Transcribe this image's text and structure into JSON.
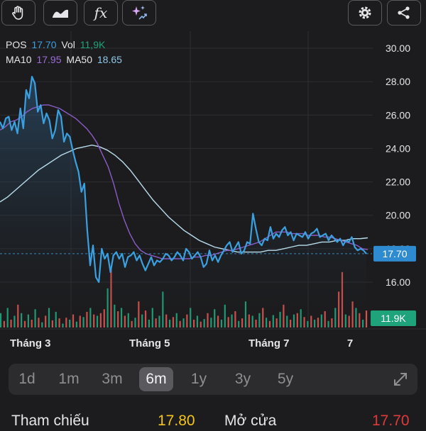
{
  "toolbar": {
    "icons": [
      "hand-icon",
      "area-chart-icon",
      "function-icon",
      "ai-sparkle-icon",
      "gear-icon",
      "share-icon"
    ],
    "function_label": "fx"
  },
  "info": {
    "ticker": "POS",
    "price": "17.70",
    "vol_label": "Vol",
    "vol": "11,9K",
    "ma10_label": "MA10",
    "ma10": "17.95",
    "ma50_label": "MA50",
    "ma50": "18.65"
  },
  "colors": {
    "price_line": "#3aa0e0",
    "ma10": "#8b5cc7",
    "ma50": "#b8dcec",
    "vol_up": "#1fa37a",
    "vol_down": "#d9534f",
    "price_tag": "#2e8bcf",
    "vol_tag": "#1fa37a",
    "ref": "#f5c518",
    "open": "#e03a3a"
  },
  "chart_data": {
    "type": "line",
    "ylim": [
      15.0,
      30.4
    ],
    "y_ticks": [
      "30.00",
      "28.00",
      "26.00",
      "24.00",
      "22.00",
      "20.00",
      "18.00",
      "16.00"
    ],
    "x_ticks": [
      "Tháng 3",
      "Tháng 5",
      "Tháng 7",
      "7"
    ],
    "current_price_tag": "17.70",
    "current_volume_tag": "11.9K",
    "series": [
      {
        "name": "POS",
        "values": [
          25.6,
          25.2,
          25.8,
          25.9,
          25.1,
          25.6,
          24.9,
          26.4,
          25.2,
          27.5,
          27.0,
          28.3,
          27.9,
          26.2,
          26.6,
          25.5,
          26.1,
          25.7,
          24.6,
          25.1,
          26.3,
          25.9,
          24.4,
          24.9,
          24.7,
          23.9,
          23.2,
          22.6,
          21.4,
          21.9,
          19.1,
          17.0,
          18.2,
          16.3,
          16.0,
          18.0,
          17.4,
          17.7,
          16.6,
          17.6,
          17.8,
          17.4,
          17.7,
          16.9,
          17.5,
          17.6,
          17.8,
          17.3,
          17.6,
          17.1,
          16.7,
          17.1,
          17.5,
          17.0,
          17.3,
          17.2,
          17.4,
          17.7,
          17.6,
          17.3,
          17.5,
          17.8,
          17.6,
          17.3,
          18.0,
          17.8,
          17.4,
          17.6,
          17.8,
          17.5,
          16.9,
          17.1,
          17.9,
          17.3,
          17.6,
          17.2,
          17.6,
          17.9,
          18.2,
          18.4,
          17.8,
          18.1,
          18.4,
          17.7,
          17.9,
          18.4,
          18.3,
          20.1,
          19.2,
          18.4,
          18.2,
          18.6,
          18.5,
          19.3,
          18.6,
          18.9,
          18.7,
          19.1,
          19.3,
          18.8,
          19.0,
          18.5,
          18.9,
          18.8,
          18.7,
          19.0,
          18.6,
          18.9,
          19.0,
          19.2,
          18.7,
          18.8,
          18.9,
          18.5,
          18.8,
          18.6,
          18.4,
          18.6,
          18.2,
          18.5,
          18.4,
          18.7,
          18.1,
          17.9,
          18.0,
          17.9,
          17.7
        ]
      },
      {
        "name": "MA10",
        "values": [
          25.1,
          25.3,
          25.6,
          25.7,
          25.9,
          26.2,
          26.4,
          26.5,
          26.6,
          26.6,
          26.5,
          26.4,
          26.2,
          26.0,
          25.8,
          25.5,
          25.2,
          24.8,
          24.3,
          23.6,
          22.9,
          21.9,
          20.7,
          19.7,
          18.9,
          18.3,
          17.9,
          17.7,
          17.6,
          17.5,
          17.4,
          17.4,
          17.4,
          17.4,
          17.4,
          17.4,
          17.5,
          17.5,
          17.6,
          17.6,
          17.7,
          17.8,
          17.9,
          17.9,
          18.0,
          18.1,
          18.2,
          18.3,
          18.4,
          18.6,
          18.8,
          19.0,
          19.0,
          19.0,
          18.9,
          18.9,
          18.9,
          18.8,
          18.8,
          18.8,
          18.7,
          18.7,
          18.6,
          18.5,
          18.4,
          18.3,
          18.2,
          18.0,
          17.95
        ]
      },
      {
        "name": "MA50",
        "values": [
          20.8,
          21.1,
          21.5,
          21.9,
          22.3,
          22.7,
          23.0,
          23.3,
          23.6,
          23.8,
          24.0,
          24.1,
          24.2,
          24.1,
          23.9,
          23.6,
          23.2,
          22.7,
          22.1,
          21.5,
          20.9,
          20.4,
          19.9,
          19.5,
          19.1,
          18.8,
          18.5,
          18.3,
          18.1,
          18.0,
          17.9,
          17.8,
          17.8,
          17.8,
          17.8,
          17.9,
          17.9,
          18.0,
          18.1,
          18.2,
          18.2,
          18.3,
          18.4,
          18.4,
          18.5,
          18.5,
          18.6,
          18.6,
          18.65
        ]
      }
    ],
    "volume": [
      {
        "v": 0.22,
        "up": 1
      },
      {
        "v": 0.1,
        "up": 0
      },
      {
        "v": 0.3,
        "up": 1
      },
      {
        "v": 0.12,
        "up": 0
      },
      {
        "v": 0.18,
        "up": 1
      },
      {
        "v": 0.35,
        "up": 0
      },
      {
        "v": 0.22,
        "up": 1
      },
      {
        "v": 0.1,
        "up": 0
      },
      {
        "v": 0.2,
        "up": 1
      },
      {
        "v": 0.12,
        "up": 0
      },
      {
        "v": 0.28,
        "up": 1
      },
      {
        "v": 0.15,
        "up": 0
      },
      {
        "v": 0.08,
        "up": 1
      },
      {
        "v": 0.18,
        "up": 0
      },
      {
        "v": 0.3,
        "up": 1
      },
      {
        "v": 0.11,
        "up": 0
      },
      {
        "v": 0.24,
        "up": 1
      },
      {
        "v": 0.14,
        "up": 0
      },
      {
        "v": 0.06,
        "up": 1
      },
      {
        "v": 0.15,
        "up": 0
      },
      {
        "v": 0.12,
        "up": 1
      },
      {
        "v": 0.2,
        "up": 0
      },
      {
        "v": 0.09,
        "up": 1
      },
      {
        "v": 0.18,
        "up": 0
      },
      {
        "v": 0.16,
        "up": 1
      },
      {
        "v": 0.24,
        "up": 0
      },
      {
        "v": 0.3,
        "up": 1
      },
      {
        "v": 0.2,
        "up": 0
      },
      {
        "v": 0.18,
        "up": 1
      },
      {
        "v": 0.22,
        "up": 0
      },
      {
        "v": 0.28,
        "up": 0
      },
      {
        "v": 0.6,
        "up": 1
      },
      {
        "v": 0.9,
        "up": 0
      },
      {
        "v": 0.35,
        "up": 1
      },
      {
        "v": 0.25,
        "up": 0
      },
      {
        "v": 0.3,
        "up": 1
      },
      {
        "v": 0.18,
        "up": 0
      },
      {
        "v": 0.22,
        "up": 1
      },
      {
        "v": 0.1,
        "up": 0
      },
      {
        "v": 0.15,
        "up": 1
      },
      {
        "v": 0.4,
        "up": 0
      },
      {
        "v": 0.2,
        "up": 1
      },
      {
        "v": 0.26,
        "up": 0
      },
      {
        "v": 0.12,
        "up": 1
      },
      {
        "v": 0.3,
        "up": 1
      },
      {
        "v": 0.14,
        "up": 0
      },
      {
        "v": 0.18,
        "up": 1
      },
      {
        "v": 0.55,
        "up": 1
      },
      {
        "v": 0.2,
        "up": 0
      },
      {
        "v": 0.12,
        "up": 1
      },
      {
        "v": 0.16,
        "up": 0
      },
      {
        "v": 0.22,
        "up": 1
      },
      {
        "v": 0.1,
        "up": 0
      },
      {
        "v": 0.14,
        "up": 1
      },
      {
        "v": 0.2,
        "up": 0
      },
      {
        "v": 0.3,
        "up": 1
      },
      {
        "v": 0.12,
        "up": 0
      },
      {
        "v": 0.18,
        "up": 1
      },
      {
        "v": 0.09,
        "up": 0
      },
      {
        "v": 0.13,
        "up": 1
      },
      {
        "v": 0.22,
        "up": 0
      },
      {
        "v": 0.15,
        "up": 1
      },
      {
        "v": 0.28,
        "up": 1
      },
      {
        "v": 0.18,
        "up": 0
      },
      {
        "v": 0.12,
        "up": 1
      },
      {
        "v": 0.35,
        "up": 1
      },
      {
        "v": 0.16,
        "up": 0
      },
      {
        "v": 0.2,
        "up": 1
      },
      {
        "v": 0.25,
        "up": 0
      },
      {
        "v": 0.1,
        "up": 1
      },
      {
        "v": 0.14,
        "up": 0
      },
      {
        "v": 0.4,
        "up": 1
      },
      {
        "v": 0.2,
        "up": 0
      },
      {
        "v": 0.18,
        "up": 1
      },
      {
        "v": 0.12,
        "up": 0
      },
      {
        "v": 0.22,
        "up": 1
      },
      {
        "v": 0.3,
        "up": 0
      },
      {
        "v": 0.15,
        "up": 1
      },
      {
        "v": 0.1,
        "up": 0
      },
      {
        "v": 0.19,
        "up": 1
      },
      {
        "v": 0.14,
        "up": 0
      },
      {
        "v": 0.24,
        "up": 1
      },
      {
        "v": 0.35,
        "up": 0
      },
      {
        "v": 0.18,
        "up": 1
      },
      {
        "v": 0.12,
        "up": 0
      },
      {
        "v": 0.2,
        "up": 1
      },
      {
        "v": 0.22,
        "up": 0
      },
      {
        "v": 0.28,
        "up": 1
      },
      {
        "v": 0.16,
        "up": 0
      },
      {
        "v": 0.1,
        "up": 1
      },
      {
        "v": 0.18,
        "up": 0
      },
      {
        "v": 0.12,
        "up": 1
      },
      {
        "v": 0.15,
        "up": 0
      },
      {
        "v": 0.2,
        "up": 1
      },
      {
        "v": 0.25,
        "up": 0
      },
      {
        "v": 0.1,
        "up": 1
      },
      {
        "v": 0.14,
        "up": 0
      },
      {
        "v": 0.3,
        "up": 1
      },
      {
        "v": 0.55,
        "up": 0
      },
      {
        "v": 0.85,
        "up": 0
      },
      {
        "v": 0.2,
        "up": 1
      },
      {
        "v": 0.18,
        "up": 0
      },
      {
        "v": 0.4,
        "up": 0
      },
      {
        "v": 0.3,
        "up": 1
      },
      {
        "v": 0.22,
        "up": 0
      },
      {
        "v": 0.12,
        "up": 1
      },
      {
        "v": 0.26,
        "up": 0
      }
    ]
  },
  "range": {
    "options": [
      "1d",
      "1m",
      "3m",
      "6m",
      "1y",
      "3y",
      "5y"
    ],
    "selected": "6m"
  },
  "footer": {
    "ref_label": "Tham chiếu",
    "ref_value": "17.80",
    "open_label": "Mở cửa",
    "open_value": "17.70"
  }
}
